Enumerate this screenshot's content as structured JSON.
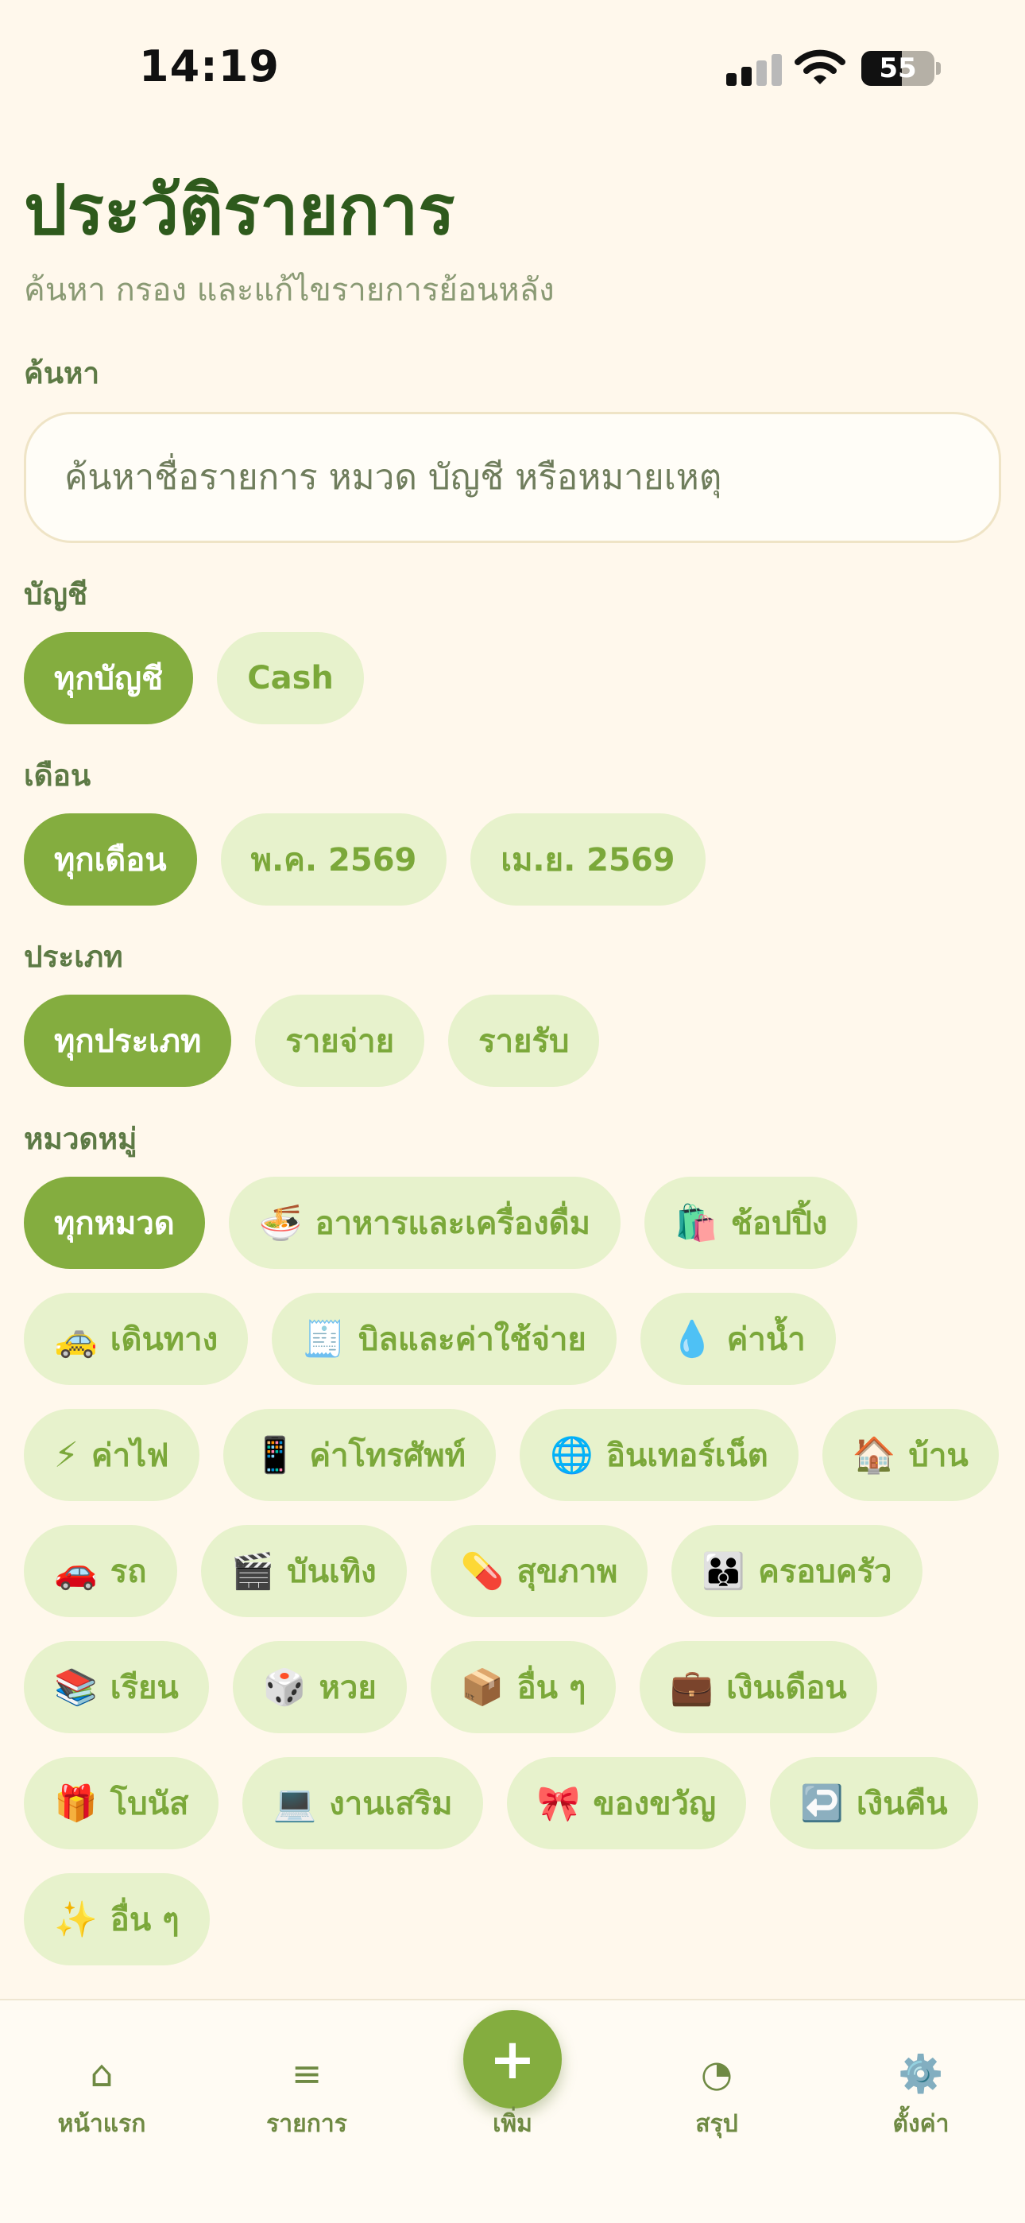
{
  "status_bar": {
    "time": "14:19",
    "battery": "55",
    "battery_level": 0.55
  },
  "header": {
    "title": "ประวัติรายการ",
    "subtitle": "ค้นหา กรอง และแก้ไขรายการย้อนหลัง"
  },
  "search": {
    "label": "ค้นหา",
    "placeholder": "ค้นหาชื่อรายการ หมวด บัญชี หรือหมายเหตุ",
    "value": ""
  },
  "account_filter": {
    "label": "บัญชี",
    "options": [
      {
        "label": "ทุกบัญชี",
        "active": true
      },
      {
        "label": "Cash",
        "active": false
      }
    ]
  },
  "month_filter": {
    "label": "เดือน",
    "options": [
      {
        "label": "ทุกเดือน",
        "active": true
      },
      {
        "label": "พ.ค. 2569",
        "active": false
      },
      {
        "label": "เม.ย. 2569",
        "active": false
      }
    ]
  },
  "type_filter": {
    "label": "ประเภท",
    "options": [
      {
        "label": "ทุกประเภท",
        "active": true
      },
      {
        "label": "รายจ่าย",
        "active": false
      },
      {
        "label": "รายรับ",
        "active": false
      }
    ]
  },
  "category_filter": {
    "label": "หมวดหมู่",
    "options": [
      {
        "label": "ทุกหมวด",
        "emoji": "",
        "active": true
      },
      {
        "label": "อาหารและเครื่องดื่ม",
        "emoji": "🍜",
        "active": false
      },
      {
        "label": "ช้อปปิ้ง",
        "emoji": "🛍️",
        "active": false
      },
      {
        "label": "เดินทาง",
        "emoji": "🚕",
        "active": false
      },
      {
        "label": "บิลและค่าใช้จ่าย",
        "emoji": "🧾",
        "active": false
      },
      {
        "label": "ค่าน้ำ",
        "emoji": "💧",
        "active": false
      },
      {
        "label": "ค่าไฟ",
        "emoji": "⚡",
        "active": false
      },
      {
        "label": "ค่าโทรศัพท์",
        "emoji": "📱",
        "active": false
      },
      {
        "label": "อินเทอร์เน็ต",
        "emoji": "🌐",
        "active": false
      },
      {
        "label": "บ้าน",
        "emoji": "🏠",
        "active": false
      },
      {
        "label": "รถ",
        "emoji": "🚗",
        "active": false
      },
      {
        "label": "บันเทิง",
        "emoji": "🎬",
        "active": false
      },
      {
        "label": "สุขภาพ",
        "emoji": "💊",
        "active": false
      },
      {
        "label": "ครอบครัว",
        "emoji": "👪",
        "active": false
      },
      {
        "label": "เรียน",
        "emoji": "📚",
        "active": false
      },
      {
        "label": "หวย",
        "emoji": "🎲",
        "active": false
      },
      {
        "label": "อื่น ๆ",
        "emoji": "📦",
        "active": false
      },
      {
        "label": "เงินเดือน",
        "emoji": "💼",
        "active": false
      },
      {
        "label": "โบนัส",
        "emoji": "🎁",
        "active": false
      },
      {
        "label": "งานเสริม",
        "emoji": "💻",
        "active": false
      },
      {
        "label": "ของขวัญ",
        "emoji": "🎀",
        "active": false
      },
      {
        "label": "เงินคืน",
        "emoji": "↩️",
        "active": false
      },
      {
        "label": "อื่น ๆ",
        "emoji": "✨",
        "active": false
      }
    ]
  },
  "bottom_nav": {
    "items": [
      {
        "label": "หน้าแรก",
        "icon": "⌂",
        "icon_name": "home-icon"
      },
      {
        "label": "รายการ",
        "icon": "≡",
        "icon_name": "list-icon"
      },
      {
        "label": "สรุป",
        "icon": "◔",
        "icon_name": "pie-chart-icon"
      },
      {
        "label": "ตั้งค่า",
        "icon": "⚙️",
        "icon_name": "gear-icon"
      }
    ],
    "add": {
      "label": "เพิ่ม",
      "icon": "+"
    }
  },
  "colors": {
    "background": "#fff8ec",
    "accent": "#84ad3f",
    "chip": "#e7f2cc",
    "title": "#2e5a1c"
  }
}
